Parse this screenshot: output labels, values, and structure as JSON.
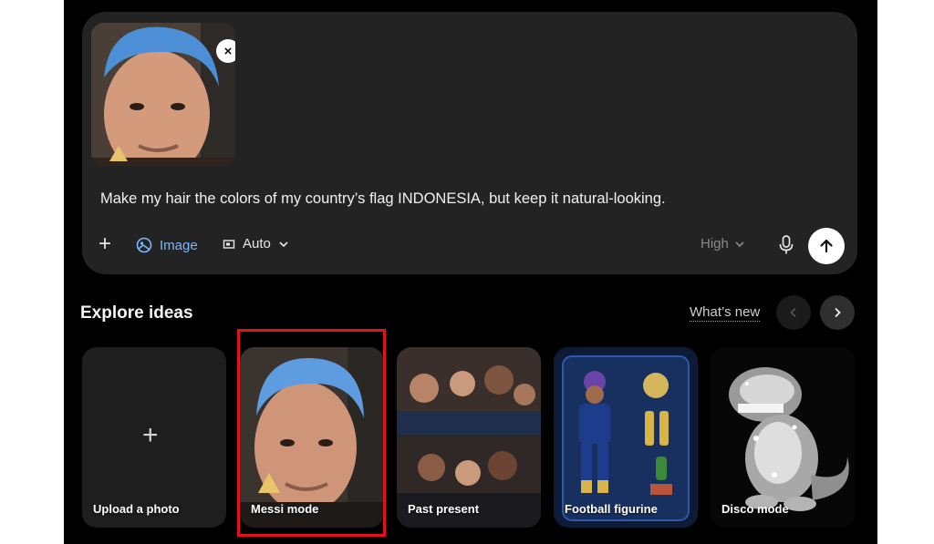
{
  "composer": {
    "prompt": "Make my hair the colors of my country’s flag INDONESIA, but keep it natural-looking.",
    "close_icon": "×",
    "plus_icon": "+",
    "image_label": "Image",
    "auto_label": "Auto",
    "quality_label": "High"
  },
  "explore": {
    "title": "Explore ideas",
    "whats_new": "What’s new",
    "cards": [
      {
        "label": "Upload a photo"
      },
      {
        "label": "Messi mode"
      },
      {
        "label": "Past present"
      },
      {
        "label": "Football figurine"
      },
      {
        "label": "Disco mode"
      }
    ]
  },
  "colors": {
    "background": "#000000",
    "composer": "#232323",
    "accent_blue": "#7cb6ff",
    "highlight_red": "#e0121b"
  },
  "icons": [
    "close-icon",
    "plus-icon",
    "image-icon",
    "aspect-ratio-icon",
    "chevron-down-icon",
    "microphone-icon",
    "arrow-up-icon",
    "chevron-left-icon",
    "chevron-right-icon"
  ]
}
